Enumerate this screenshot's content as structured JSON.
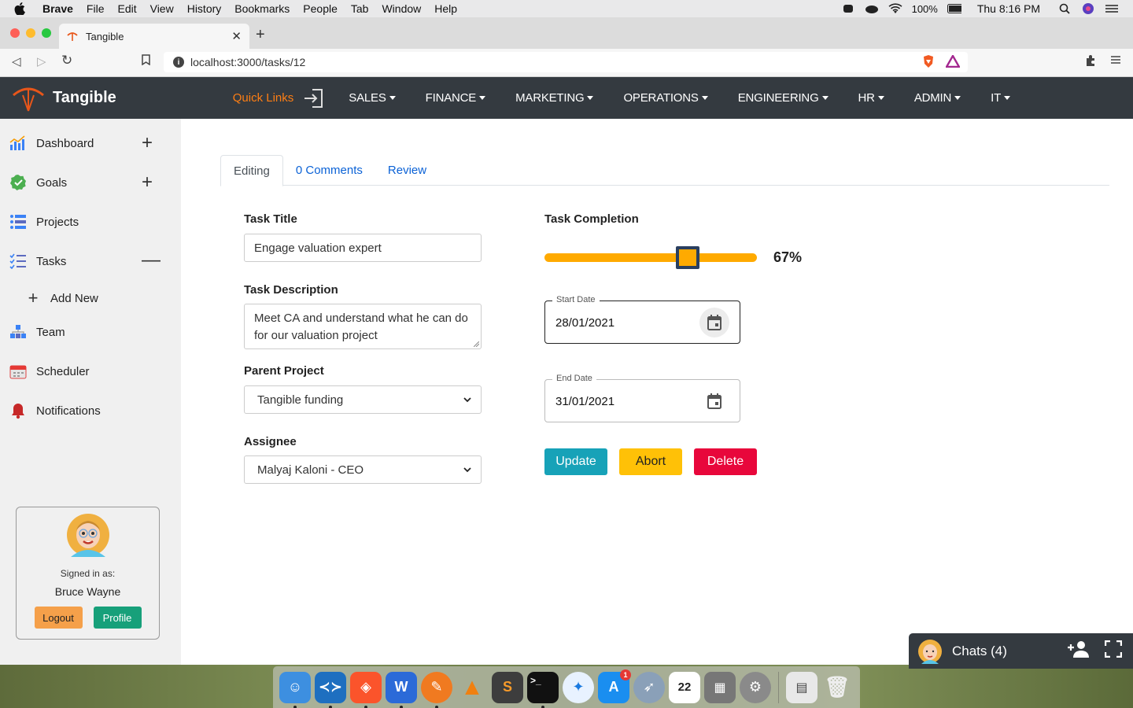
{
  "menubar": {
    "app": "Brave",
    "items": [
      "File",
      "Edit",
      "View",
      "History",
      "Bookmarks",
      "People",
      "Tab",
      "Window",
      "Help"
    ],
    "battery": "100%",
    "clock": "Thu 8:16 PM"
  },
  "browser": {
    "tab_title": "Tangible",
    "url": "localhost:3000/tasks/12"
  },
  "header": {
    "brand": "Tangible",
    "quick_links": "Quick Links",
    "nav": [
      "SALES",
      "FINANCE",
      "MARKETING",
      "OPERATIONS",
      "ENGINEERING",
      "HR",
      "ADMIN",
      "IT"
    ]
  },
  "sidebar": {
    "items": [
      {
        "label": "Dashboard",
        "icon": "chart-icon"
      },
      {
        "label": "Goals",
        "icon": "check-circle-icon"
      },
      {
        "label": "Projects",
        "icon": "list-icon"
      },
      {
        "label": "Tasks",
        "icon": "checklist-icon"
      },
      {
        "label": "Add New",
        "icon": "plus-icon"
      },
      {
        "label": "Team",
        "icon": "team-icon"
      },
      {
        "label": "Scheduler",
        "icon": "calendar-icon"
      },
      {
        "label": "Notifications",
        "icon": "bell-icon"
      }
    ],
    "signed_in_as": "Signed in as:",
    "user_name": "Bruce Wayne",
    "logout": "Logout",
    "profile": "Profile"
  },
  "tabs": [
    "Editing",
    "0 Comments",
    "Review"
  ],
  "form": {
    "task_title_label": "Task Title",
    "task_title_value": "Engage valuation expert",
    "task_desc_label": "Task Description",
    "task_desc_line1": "Meet CA and understand what he can do",
    "task_desc_line2": "for our valuation project",
    "parent_project_label": "Parent Project",
    "parent_project_value": "Tangible funding",
    "assignee_label": "Assignee",
    "assignee_value": "Malyaj Kaloni - CEO",
    "completion_label": "Task Completion",
    "completion_value": 0.67,
    "completion_text": "67%",
    "start_date_label": "Start Date",
    "start_date_value": "28/01/2021",
    "end_date_label": "End Date",
    "end_date_value": "31/01/2021"
  },
  "actions": {
    "update": "Update",
    "abort": "Abort",
    "delete": "Delete"
  },
  "chat": {
    "label": "Chats (4)"
  },
  "colors": {
    "header_bg": "#343a40",
    "accent_orange": "#fd7e14",
    "slider": "#ffaa00",
    "update": "#17a2b8",
    "abort": "#ffc107",
    "delete": "#e8073b"
  }
}
